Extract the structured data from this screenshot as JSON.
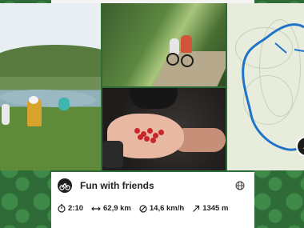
{
  "tour": {
    "title": "Fun with friends",
    "map_marker": "A"
  },
  "stats": [
    {
      "icon": "stopwatch-icon",
      "value": "2:10"
    },
    {
      "icon": "distance-icon",
      "value": "62,9 km"
    },
    {
      "icon": "speed-icon",
      "value": "14,6 km/h"
    },
    {
      "icon": "elevation-icon",
      "value": "1345 m"
    }
  ],
  "colors": {
    "brand_green": "#2f6b37",
    "route_blue": "#1e74c8"
  }
}
